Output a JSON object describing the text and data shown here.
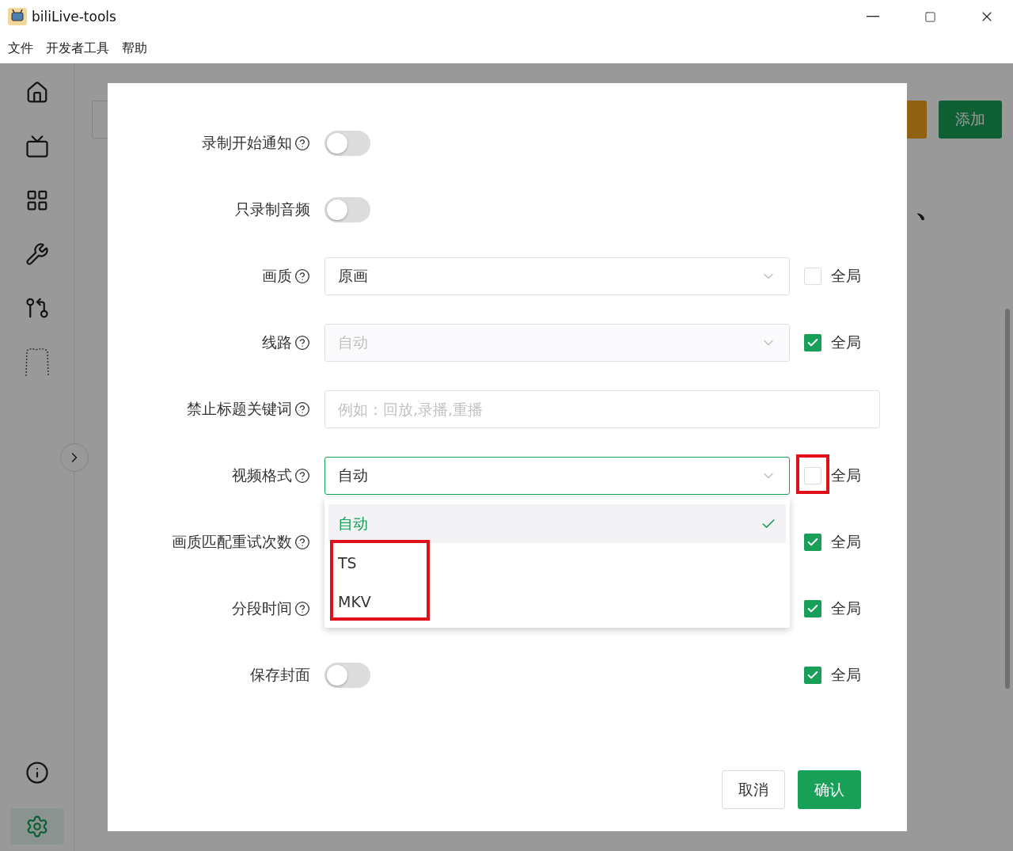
{
  "window": {
    "title": "biliLive-tools"
  },
  "menu": [
    "文件",
    "开发者工具",
    "帮助"
  ],
  "sidebar": {
    "items": [
      {
        "kind": "home",
        "selected": false
      },
      {
        "kind": "tv",
        "selected": false
      },
      {
        "kind": "grid",
        "selected": false
      },
      {
        "kind": "wrench",
        "selected": false
      },
      {
        "kind": "merge",
        "selected": false
      },
      {
        "kind": "doodle",
        "selected": false
      }
    ],
    "bottom_items": [
      {
        "kind": "info",
        "selected": false
      },
      {
        "kind": "settings",
        "selected": true
      }
    ]
  },
  "background": {
    "add_button": "添加",
    "heading_right": "、"
  },
  "dialog": {
    "fields": [
      {
        "kind": "toggle",
        "label": "录制开始通知",
        "help": true,
        "on": false
      },
      {
        "kind": "toggle",
        "label": "只录制音频",
        "help": false,
        "on": false
      },
      {
        "kind": "select",
        "label": "画质",
        "help": true,
        "value": "原画",
        "disabled": false,
        "focused": false,
        "global": {
          "checked": false,
          "label": "全局"
        }
      },
      {
        "kind": "select",
        "label": "线路",
        "help": true,
        "value": "自动",
        "disabled": true,
        "focused": false,
        "global": {
          "checked": true,
          "label": "全局"
        }
      },
      {
        "kind": "input",
        "label": "禁止标题关键词",
        "help": true,
        "placeholder": "例如：回放,录播,重播"
      },
      {
        "kind": "select",
        "label": "视频格式",
        "help": true,
        "value": "自动",
        "disabled": false,
        "focused": true,
        "global": {
          "checked": false,
          "label": "全局",
          "highlighted": true
        },
        "options": [
          {
            "label": "自动",
            "selected": true,
            "highlighted": false
          },
          {
            "label": "TS",
            "selected": false,
            "highlighted": true
          },
          {
            "label": "MKV",
            "selected": false,
            "highlighted": true
          }
        ]
      },
      {
        "kind": "covered",
        "label": "画质匹配重试次数",
        "help": true,
        "global": {
          "checked": true,
          "label": "全局"
        }
      },
      {
        "kind": "covered",
        "label": "分段时间",
        "help": true,
        "global": {
          "checked": true,
          "label": "全局"
        }
      },
      {
        "kind": "toggle",
        "label": "保存封面",
        "help": false,
        "on": false,
        "global": {
          "checked": true,
          "label": "全局"
        }
      }
    ],
    "buttons": [
      {
        "label": "取消",
        "kind": "default"
      },
      {
        "label": "确认",
        "kind": "primary"
      }
    ]
  }
}
